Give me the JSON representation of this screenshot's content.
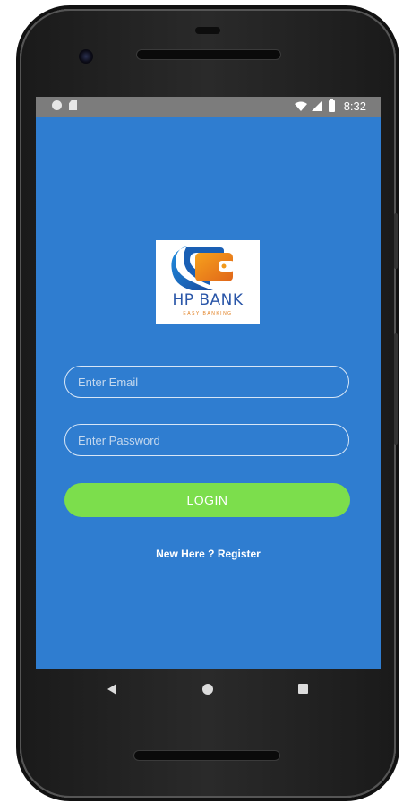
{
  "status_bar": {
    "time": "8:32",
    "icons": [
      "notification-dot-icon",
      "sd-card-icon",
      "wifi-icon",
      "signal-icon",
      "battery-icon"
    ]
  },
  "logo": {
    "title": "HP BANK",
    "tagline": "EASY BANKING",
    "colors": {
      "primary": "#2a56a8",
      "accent": "#e07b1a"
    }
  },
  "form": {
    "email_placeholder": "Enter Email",
    "email_value": "",
    "password_placeholder": "Enter Password",
    "password_value": "",
    "login_label": "LOGIN",
    "register_label": "New Here ? Register"
  },
  "nav_bar": {
    "icons": [
      "back-icon",
      "home-icon",
      "recents-icon"
    ]
  },
  "colors": {
    "screen_background": "#2f7dd0",
    "login_button": "#7cde4c",
    "status_bar": "#7c7c7c"
  }
}
